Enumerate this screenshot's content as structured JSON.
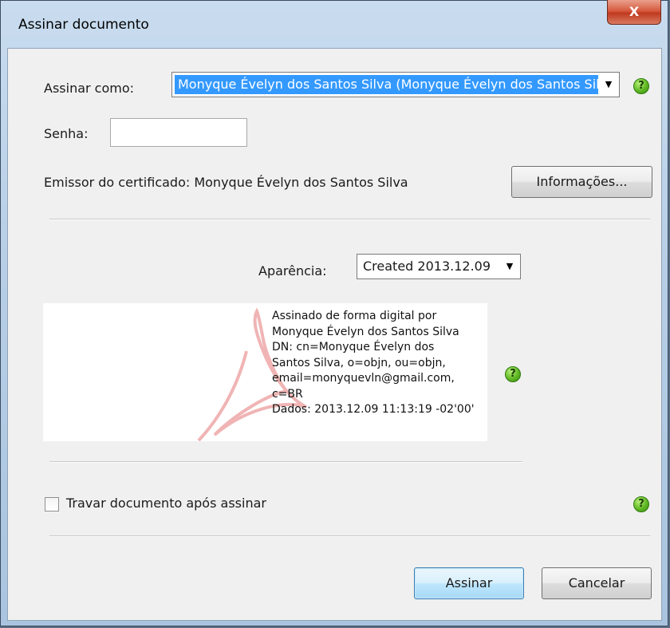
{
  "window": {
    "title": "Assinar documento",
    "close_label": "X"
  },
  "form": {
    "sign_as_label": "Assinar como:",
    "sign_as_value": "Monyque Évelyn dos Santos Silva (Monyque Évelyn dos Santos Silva)",
    "password_label": "Senha:",
    "password_value": "",
    "issuer_label": "Emissor do certificado: Monyque Évelyn dos Santos Silva",
    "info_button": "Informações...",
    "appearance_label": "Aparência:",
    "appearance_value": "Created 2013.12.09",
    "lock_label": "Travar documento após assinar",
    "lock_checked": false
  },
  "preview": {
    "signature_text": "Assinado de forma digital por\nMonyque Évelyn dos Santos Silva\nDN: cn=Monyque Évelyn dos\nSantos Silva, o=objn, ou=objn,\nemail=monyquevln@gmail.com,\nc=BR\nDados: 2013.12.09 11:13:19 -02'00'"
  },
  "buttons": {
    "sign": "Assinar",
    "cancel": "Cancelar"
  },
  "icons": {
    "help": "help-icon",
    "dropdown": "chevron-down-icon",
    "watermark": "acrobat-logo"
  },
  "colors": {
    "selection": "#3399ff",
    "help_green": "#5fb823",
    "close_red": "#c0391f"
  }
}
